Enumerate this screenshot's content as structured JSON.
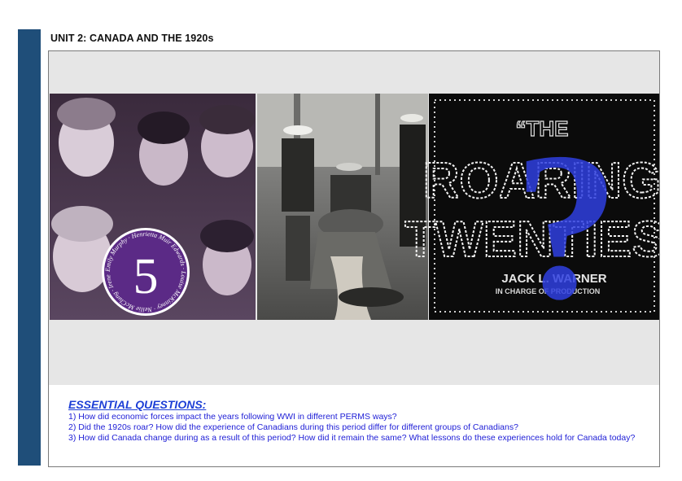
{
  "header": {
    "unit_title": "UNIT 2: CANADA AND THE 1920s"
  },
  "banner": {
    "medallion_number": "5",
    "medallion_text": "Emily Murphy · Henrietta Muir Edwards · Louise McKinney · Nellie McClung · Irene Parlby",
    "poster_the": "“THE",
    "poster_roaring": "ROARING",
    "poster_twenties": "TWENTIES’",
    "poster_credit": "JACK L. WARNER",
    "poster_credit_sub": "IN CHARGE OF PRODUCTION",
    "question_mark": "?",
    "colors": {
      "medallion": "#5b2a86",
      "question_mark": "#2f3fe0",
      "sidebar": "#1f4e79"
    }
  },
  "essential_questions": {
    "heading": "ESSENTIAL QUESTIONS:",
    "items": [
      "1) How did economic forces impact the years following WWI in different PERMS ways?",
      "2) Did the 1920s roar? How did the experience of Canadians during this period differ for different groups of Canadians?",
      "3) How did Canada change during as a result of this period? How did it remain the same? What lessons do these experiences hold for Canada today?"
    ]
  }
}
